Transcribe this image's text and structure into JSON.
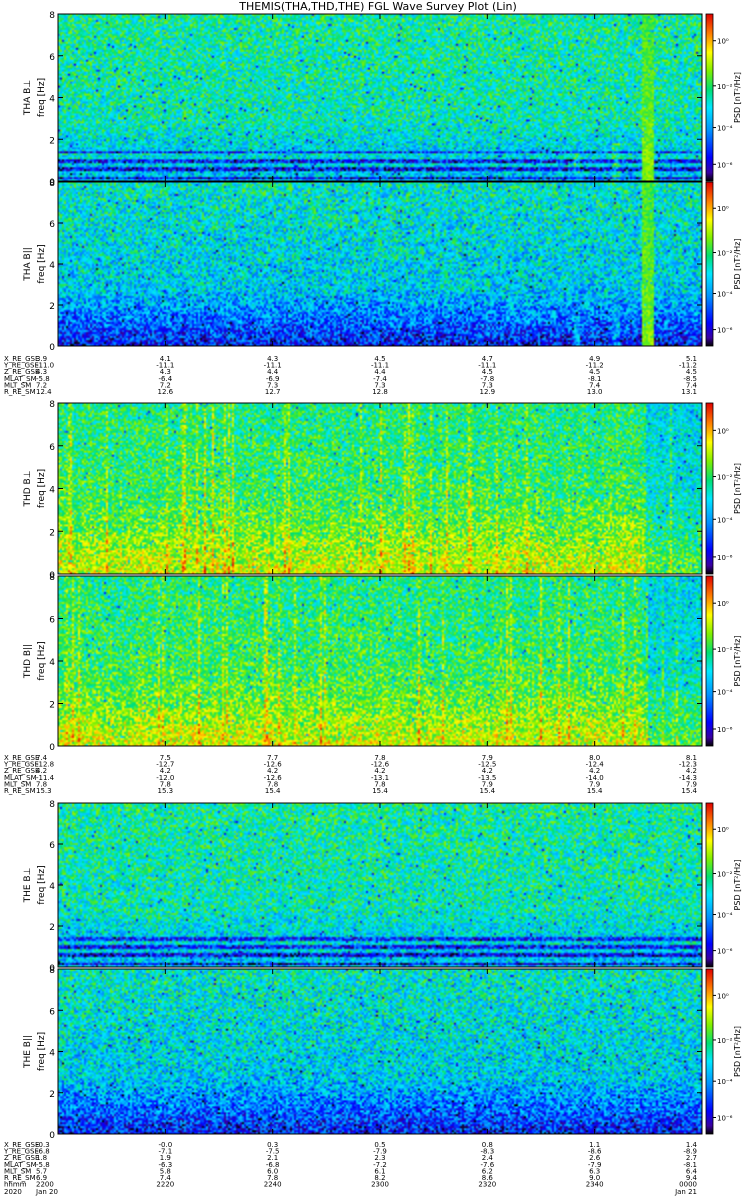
{
  "title": "THEMIS(THA,THD,THE) FGL Wave Survey Plot (Lin)",
  "colorbar": {
    "label": "PSD [nT²/Hz]",
    "ticks": [
      "10⁰",
      "10⁻²",
      "10⁻⁴",
      "10⁻⁶"
    ]
  },
  "freq_axis": {
    "label": "freq [Hz]",
    "ticks": [
      "0",
      "2",
      "4",
      "6",
      "8"
    ]
  },
  "chart_data": [
    {
      "type": "heatmap",
      "panel": "THA B⊥",
      "ylabel": "THA B⊥",
      "ylim": [
        0,
        8
      ],
      "features": {
        "background": "cyan-green",
        "low_freq_bands": true,
        "bursts_near_end": true
      }
    },
    {
      "type": "heatmap",
      "panel": "THA B||",
      "ylabel": "THA B||",
      "ylim": [
        0,
        8
      ],
      "features": {
        "background": "blue-cyan",
        "low_freq_bands": false,
        "bursts_near_end": true
      }
    },
    {
      "type": "heatmap",
      "panel": "THD B⊥",
      "ylabel": "THD B⊥",
      "ylim": [
        0,
        8
      ],
      "features": {
        "background": "green-yellow",
        "low_freq_bands": false,
        "bursts_near_end": false
      }
    },
    {
      "type": "heatmap",
      "panel": "THD B||",
      "ylabel": "THD B||",
      "ylim": [
        0,
        8
      ],
      "features": {
        "background": "green-yellow",
        "low_freq_bands": false,
        "bursts_near_end": false
      }
    },
    {
      "type": "heatmap",
      "panel": "THE B⊥",
      "ylabel": "THE B⊥",
      "ylim": [
        0,
        8
      ],
      "features": {
        "background": "cyan-green",
        "low_freq_bands": true,
        "bursts_near_end": false
      }
    },
    {
      "type": "heatmap",
      "panel": "THE B||",
      "ylabel": "THE B||",
      "ylim": [
        0,
        8
      ],
      "features": {
        "background": "blue-cyan",
        "low_freq_bands": false,
        "bursts_near_end": false
      }
    }
  ],
  "ephemeris": [
    {
      "probe": "THA",
      "rows": [
        {
          "label": "X_RE_GSE",
          "values": [
            "3.9",
            "4.1",
            "4.3",
            "4.5",
            "4.7",
            "4.9",
            "5.1"
          ]
        },
        {
          "label": "Y_RE_GSE",
          "values": [
            "-11.0",
            "-11.1",
            "-11.1",
            "-11.1",
            "-11.1",
            "-11.2",
            "-11.2"
          ]
        },
        {
          "label": "Z_RE_GSE",
          "values": [
            "4.3",
            "4.3",
            "4.4",
            "4.4",
            "4.5",
            "4.5",
            "4.5"
          ]
        },
        {
          "label": "MLAT_SM",
          "values": [
            "-5.8",
            "-6.4",
            "-6.9",
            "-7.4",
            "-7.8",
            "-8.1",
            "-8.5"
          ]
        },
        {
          "label": "MLT_SM",
          "values": [
            "7.2",
            "7.2",
            "7.3",
            "7.3",
            "7.3",
            "7.4",
            "7.4"
          ]
        },
        {
          "label": "R_RE_SM",
          "values": [
            "12.4",
            "12.6",
            "12.7",
            "12.8",
            "12.9",
            "13.0",
            "13.1"
          ]
        }
      ]
    },
    {
      "probe": "THD",
      "rows": [
        {
          "label": "X_RE_GSE",
          "values": [
            "7.4",
            "7.5",
            "7.7",
            "7.8",
            "7.9",
            "8.0",
            "8.1"
          ]
        },
        {
          "label": "Y_RE_GSE",
          "values": [
            "-12.8",
            "-12.7",
            "-12.6",
            "-12.6",
            "-12.5",
            "-12.4",
            "-12.3"
          ]
        },
        {
          "label": "Z_RE_GSE",
          "values": [
            "4.2",
            "4.2",
            "4.2",
            "4.2",
            "4.2",
            "4.2",
            "4.2"
          ]
        },
        {
          "label": "MLAT_SM",
          "values": [
            "-11.4",
            "-12.0",
            "-12.6",
            "-13.1",
            "-13.5",
            "-14.0",
            "-14.3"
          ]
        },
        {
          "label": "MLT_SM",
          "values": [
            "7.8",
            "7.8",
            "7.8",
            "7.8",
            "7.9",
            "7.9",
            "7.9"
          ]
        },
        {
          "label": "R_RE_SM",
          "values": [
            "15.3",
            "15.3",
            "15.4",
            "15.4",
            "15.4",
            "15.4",
            "15.4"
          ]
        }
      ]
    },
    {
      "probe": "THE",
      "rows": [
        {
          "label": "X_RE_GSE",
          "values": [
            "-0.3",
            "-0.0",
            "0.3",
            "0.5",
            "0.8",
            "1.1",
            "1.4"
          ]
        },
        {
          "label": "Y_RE_GSE",
          "values": [
            "-6.8",
            "-7.1",
            "-7.5",
            "-7.9",
            "-8.3",
            "-8.6",
            "-8.9"
          ]
        },
        {
          "label": "Z_RE_GSE",
          "values": [
            "1.8",
            "1.9",
            "2.1",
            "2.3",
            "2.4",
            "2.6",
            "2.7"
          ]
        },
        {
          "label": "MLAT_SM",
          "values": [
            "-5.8",
            "-6.3",
            "-6.8",
            "-7.2",
            "-7.6",
            "-7.9",
            "-8.1"
          ]
        },
        {
          "label": "MLT_SM",
          "values": [
            "5.7",
            "5.8",
            "6.0",
            "6.1",
            "6.2",
            "6.3",
            "6.4"
          ]
        },
        {
          "label": "R_RE_SM",
          "values": [
            "6.9",
            "7.4",
            "7.8",
            "8.2",
            "8.6",
            "9.0",
            "9.4"
          ]
        }
      ]
    }
  ],
  "time_axis": {
    "row1_label": "hhmm",
    "row2_label": "2020",
    "row1": [
      "2200",
      "2220",
      "2240",
      "2300",
      "2320",
      "2340",
      "0000"
    ],
    "row2": [
      "Jan 20",
      "",
      "",
      "",
      "",
      "",
      "Jan 21"
    ]
  }
}
